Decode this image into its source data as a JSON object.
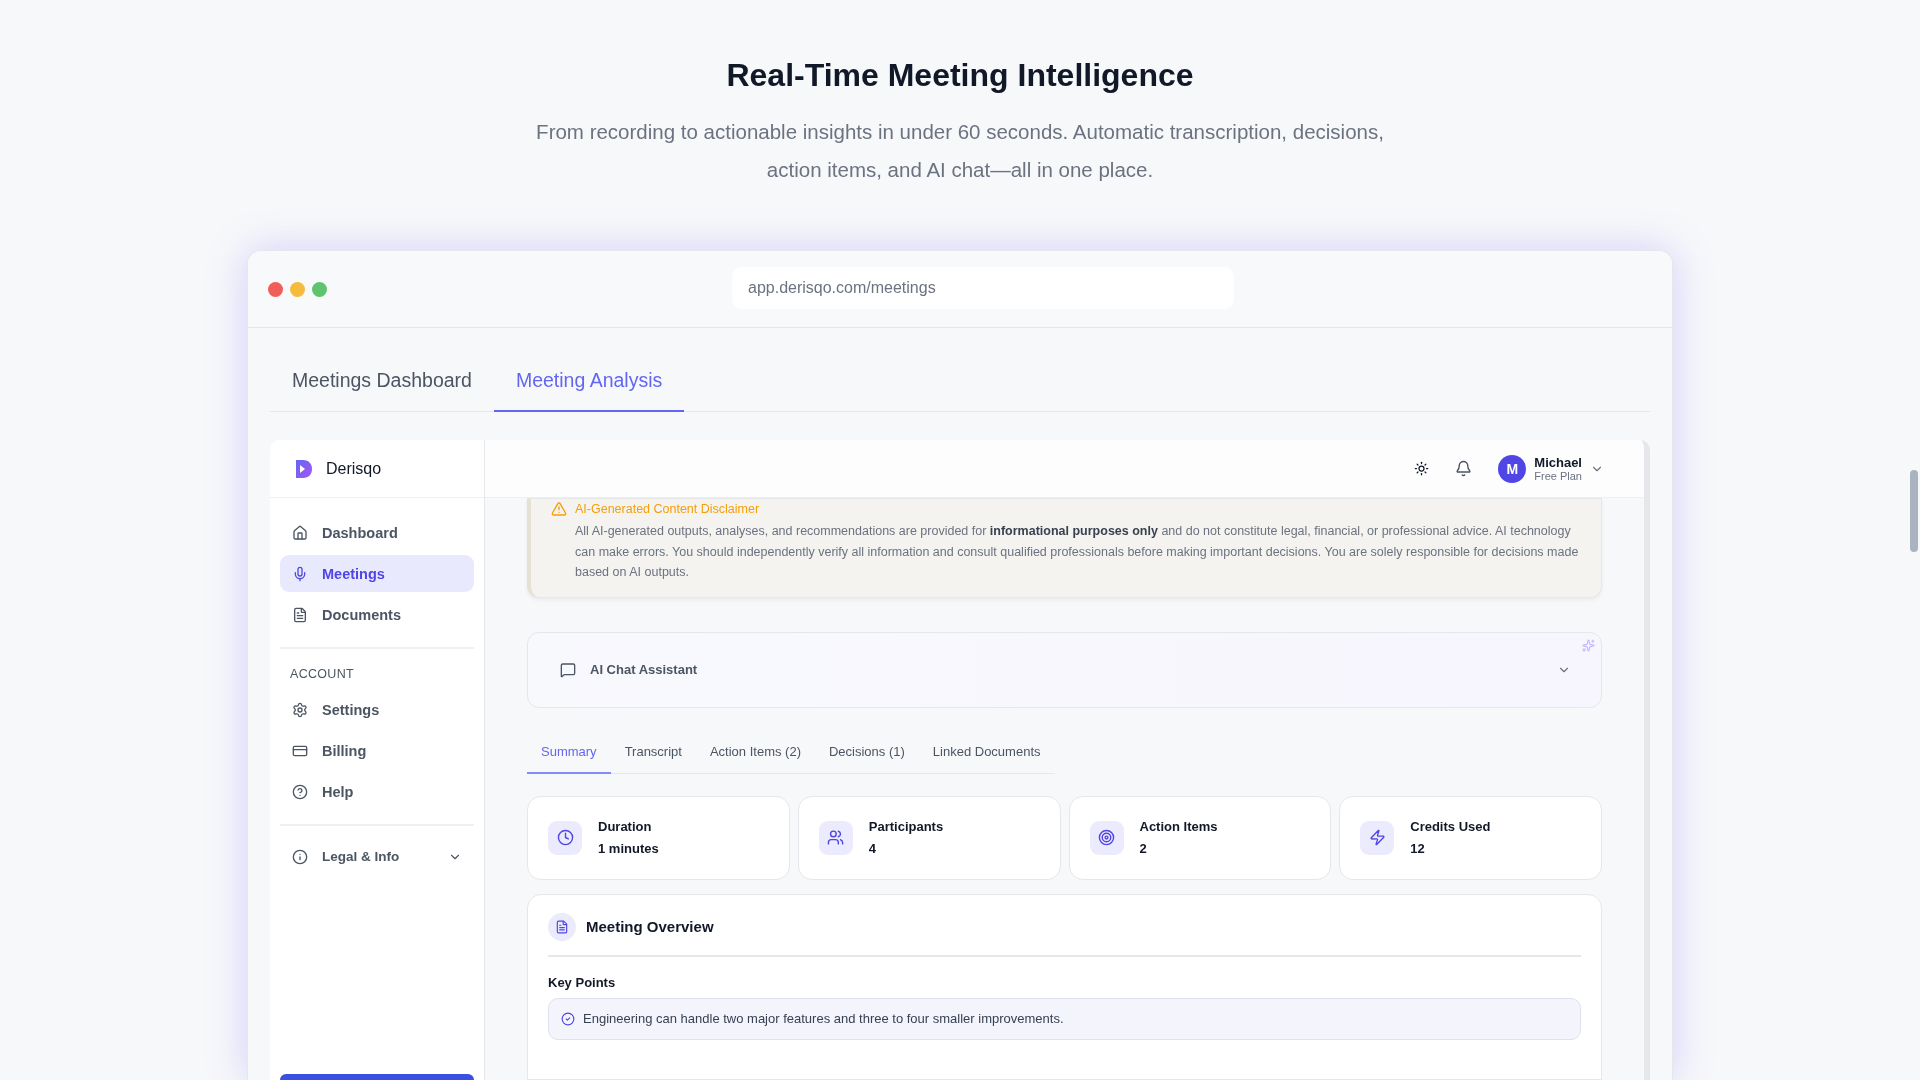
{
  "hero": {
    "title": "Real-Time Meeting Intelligence",
    "subtitle_lines": [
      "From recording to actionable insights in under 60 seconds. Automatic transcription, decisions,",
      "action items, and AI chat—all in one place."
    ]
  },
  "browser": {
    "url": "app.derisqo.com/meetings"
  },
  "page_tabs": [
    {
      "label": "Meetings Dashboard",
      "selected": false
    },
    {
      "label": "Meeting Analysis",
      "selected": true
    }
  ],
  "sidebar": {
    "brand": "Derisqo",
    "nav": [
      {
        "label": "Dashboard",
        "selected": false
      },
      {
        "label": "Meetings",
        "selected": true
      },
      {
        "label": "Documents",
        "selected": false
      }
    ],
    "account_heading": "ACCOUNT",
    "account_nav": [
      {
        "label": "Settings",
        "selected": false
      },
      {
        "label": "Billing",
        "selected": false
      },
      {
        "label": "Help",
        "selected": false
      }
    ],
    "legal": {
      "label": "Legal & Info",
      "expanded": false
    }
  },
  "user": {
    "initial": "M",
    "name": "Michael",
    "plan": "Free Plan"
  },
  "disclaimer": {
    "title": "AI-Generated Content Disclaimer",
    "text": "All AI-generated outputs, analyses, and recommendations are provided for **informational purposes only** and do not constitute legal, financial, or professional advice. AI technology can make errors. You should independently verify all information and consult qualified professionals before making important decisions. You are solely responsible for decisions made based on AI outputs."
  },
  "chat": {
    "label": "AI Chat Assistant",
    "expanded": false
  },
  "tabs": [
    {
      "label": "Summary",
      "selected": true
    },
    {
      "label": "Transcript",
      "selected": false
    },
    {
      "label": "Action Items (2)",
      "selected": false
    },
    {
      "label": "Decisions (1)",
      "selected": false
    },
    {
      "label": "Linked Documents",
      "selected": false
    }
  ],
  "stats": [
    {
      "label": "Duration",
      "value": "1 minutes"
    },
    {
      "label": "Participants",
      "value": "4"
    },
    {
      "label": "Action Items",
      "value": "2"
    },
    {
      "label": "Credits Used",
      "value": "12"
    }
  ],
  "overview": {
    "title": "Meeting Overview",
    "key_points_heading": "Key Points",
    "key_points": [
      "Engineering can handle two major features and three to four smaller improvements."
    ]
  }
}
